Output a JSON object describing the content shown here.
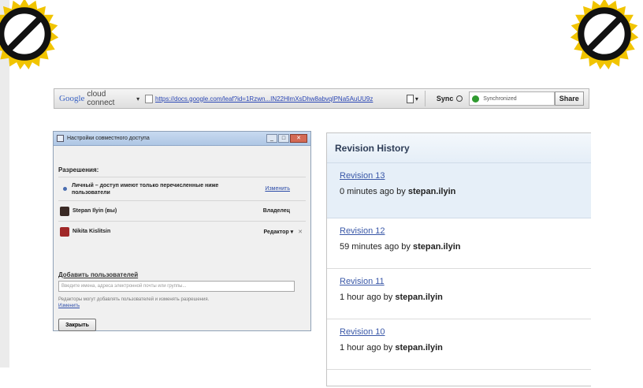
{
  "toolbar": {
    "logo": "Google",
    "logo_sub": "cloud connect",
    "caret": "▾",
    "url": "https://docs.google.com/leaf?id=1Rzwn...IN22HlmXsDhw8abvqIPNa5AuUU9z",
    "doc_caret": "▾",
    "sync_label": "Sync",
    "status": "Synchronized",
    "share_label": "Share"
  },
  "dialog": {
    "title": "Настройки совместного доступа",
    "permissions_title": "Разрешения:",
    "private_text": "Личный – доступ имеют только перечисленные ниже пользователи",
    "change_link": "Изменить",
    "owner_name": "Stepan Ilyin (вы)",
    "owner_role": "Владелец",
    "editor_name": "Nikita Kislitsin",
    "editor_role": "Редактор ▾",
    "remove_x": "✕",
    "add_title": "Добавить пользователей",
    "add_placeholder": "Введите имена, адреса электронной почты или группы...",
    "note_text": "Редакторы могут добавлять пользователей и изменять разрешения.",
    "note_link": "Изменить",
    "close_button": "Закрыть",
    "ctrl_min": "_",
    "ctrl_max": "□",
    "ctrl_close": "✕"
  },
  "revision_history": {
    "title": "Revision History",
    "revisions": [
      {
        "label": "Revision 13",
        "time": "0 minutes ago by",
        "user": "stepan.ilyin"
      },
      {
        "label": "Revision 12",
        "time": "59 minutes ago by",
        "user": "stepan.ilyin"
      },
      {
        "label": "Revision 11",
        "time": "1 hour ago by",
        "user": "stepan.ilyin"
      },
      {
        "label": "Revision 10",
        "time": "1 hour ago by",
        "user": "stepan.ilyin"
      }
    ]
  },
  "colors": {
    "sign_gold": "#f1c400",
    "sign_black": "#111111",
    "selected_row": "#e6eff8"
  }
}
